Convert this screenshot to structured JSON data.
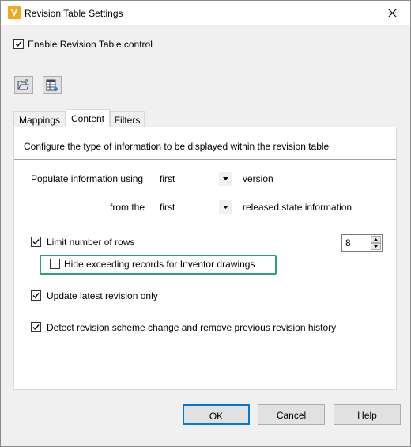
{
  "window": {
    "title": "Revision Table Settings",
    "accent": "#0078d7"
  },
  "icons": {
    "app": "vault-v-icon",
    "close": "close-icon",
    "open": "open-folder-icon",
    "table": "table-settings-icon"
  },
  "enable_control": {
    "label": "Enable Revision Table control",
    "checked": true
  },
  "tabs": [
    {
      "label": "Mappings",
      "active": false
    },
    {
      "label": "Content",
      "active": true
    },
    {
      "label": "Filters",
      "active": false
    }
  ],
  "content": {
    "description": "Configure the type of information to be displayed within the revision table",
    "populate": {
      "label": "Populate information using",
      "value": "first",
      "suffix": "version"
    },
    "from": {
      "label": "from the",
      "value": "first",
      "suffix": "released state information"
    },
    "limit_rows": {
      "label": "Limit number of rows",
      "checked": true,
      "value": "8"
    },
    "hide_exceeding": {
      "label": "Hide exceeding records for Inventor drawings",
      "checked": false,
      "highlight_color": "#2e9e7e"
    },
    "update_latest": {
      "label": "Update latest revision only",
      "checked": true
    },
    "detect_scheme": {
      "label": "Detect revision scheme change and remove previous revision history",
      "checked": true
    }
  },
  "buttons": {
    "ok": "OK",
    "cancel": "Cancel",
    "help": "Help"
  }
}
